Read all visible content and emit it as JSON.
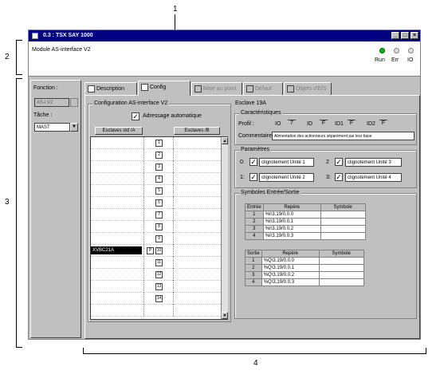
{
  "callouts": {
    "c1": "1",
    "c2": "2",
    "c3": "3",
    "c4": "4"
  },
  "window": {
    "title": "0.3 : TSX SAY 1000"
  },
  "header": {
    "module_name": "Module AS-interface V2",
    "leds": [
      {
        "label": "Run",
        "color": "#00c000"
      },
      {
        "label": "Err",
        "color": "#c0c0c0"
      },
      {
        "label": "IO",
        "color": "#c0c0c0"
      }
    ]
  },
  "left": {
    "fonction_label": "Fonction :",
    "fonction_value": "AS-i V2",
    "tache_label": "Tâche :",
    "tache_value": "MAST"
  },
  "tabs": [
    {
      "label": "Description"
    },
    {
      "label": "Config"
    },
    {
      "label": "Mise au point"
    },
    {
      "label": "Défaut"
    },
    {
      "label": "Objets d'E/S"
    }
  ],
  "config": {
    "title": "Configuration AS-interface V2",
    "auto_addr_label": "Adressage automatique",
    "col_a": "Esclaves std /A",
    "col_b": "Esclaves /B",
    "slave_names": [
      "",
      "",
      "",
      "",
      "",
      "",
      "",
      "",
      "",
      "XVBC21A",
      "",
      "",
      "",
      "",
      ""
    ],
    "slave_numbers": [
      "1",
      "2",
      "3",
      "4",
      "5",
      "6",
      "7",
      "8",
      "9",
      "10",
      "11",
      "12",
      "13",
      "14"
    ],
    "p_marker": "P"
  },
  "slave": {
    "title": "Esclave 19A",
    "carac_title": "Caractéristiques",
    "profil_label": "Profil :",
    "profil_io": "IO",
    "profil_io_v": "7",
    "profil_id": "ID",
    "profil_id_v": "F",
    "profil_id1": "ID1",
    "profil_id1_v": "F",
    "profil_id2": "ID2",
    "profil_id2_v": "F",
    "comment_label": "Commentaire",
    "comment_value": "Alimentation des actionneurs séparément par leur base",
    "param_title": "Paramètres",
    "params": [
      {
        "num": "0:",
        "label": "clignotement Unité 1"
      },
      {
        "num": "2",
        "label": "clignotement Unité 3"
      },
      {
        "num": "1:",
        "label": "clignotement Unité 2"
      },
      {
        "num": "3:",
        "label": "clignotement Unité 4"
      }
    ],
    "sym_title": "Symboles Entrée/Sortie",
    "in_head": [
      "Entrée",
      "Repère",
      "Symbole"
    ],
    "inputs": [
      {
        "n": "1",
        "r": "%I\\3.19/0.0.0"
      },
      {
        "n": "2",
        "r": "%I\\3.19/0.0.1"
      },
      {
        "n": "3",
        "r": "%I\\3.19/0.0.2"
      },
      {
        "n": "4",
        "r": "%I\\3.19/0.0.3"
      }
    ],
    "out_head": [
      "Sortie",
      "Repère",
      "Symbole"
    ],
    "outputs": [
      {
        "n": "1",
        "r": "%Q\\3.19/0.0.0"
      },
      {
        "n": "2",
        "r": "%Q\\3.19/0.0.1"
      },
      {
        "n": "3",
        "r": "%Q\\3.19/0.0.2"
      },
      {
        "n": "4",
        "r": "%Q\\3.19/0.0.3"
      }
    ]
  }
}
